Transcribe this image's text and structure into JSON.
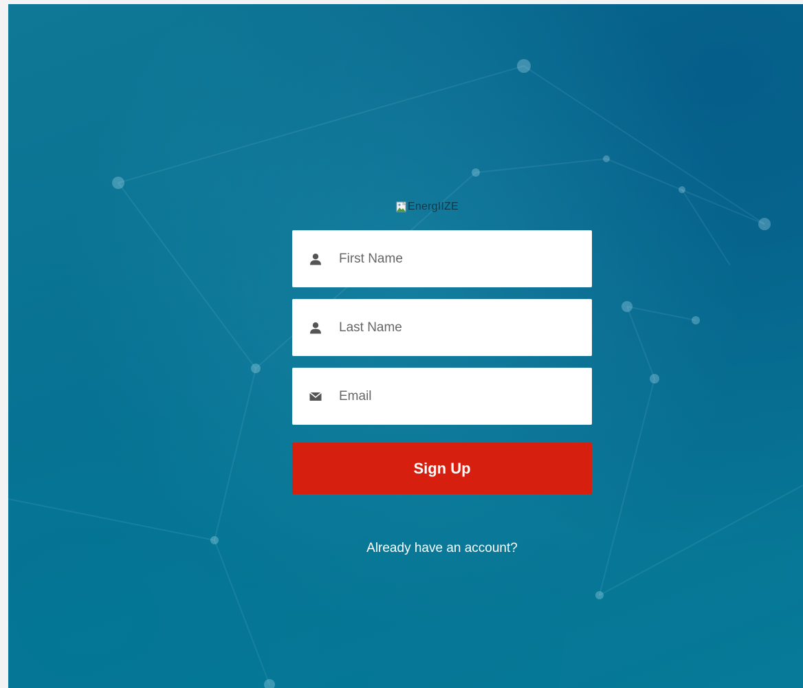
{
  "logo": {
    "alt_text": "EnergIIZE"
  },
  "form": {
    "first_name": {
      "placeholder": "First Name",
      "value": ""
    },
    "last_name": {
      "placeholder": "Last Name",
      "value": ""
    },
    "email": {
      "placeholder": "Email",
      "value": ""
    },
    "submit_label": "Sign Up",
    "login_link": "Already have an account?"
  },
  "colors": {
    "background": "#0a7292",
    "button": "#d71f10",
    "field": "#ffffff",
    "icon": "#555555"
  },
  "icons": {
    "first_name": "user-icon",
    "last_name": "user-icon",
    "email": "envelope-icon"
  }
}
